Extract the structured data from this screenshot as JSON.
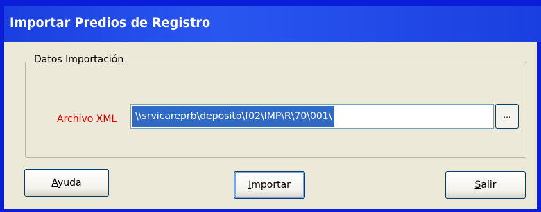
{
  "window": {
    "title": "Importar Predios de Registro"
  },
  "group": {
    "label": "Datos Importación"
  },
  "file_field": {
    "label": "Archivo XML",
    "value": "\\\\srvicareprb\\deposito\\f02\\IMP\\R\\70\\001\\",
    "browse_label": "..."
  },
  "buttons": {
    "help": {
      "mnemonic": "A",
      "rest": "yuda"
    },
    "import": {
      "mnemonic": "I",
      "rest": "mportar"
    },
    "exit": {
      "mnemonic": "S",
      "rest": "alir"
    }
  },
  "colors": {
    "title_bar": "#2a56f0",
    "selection": "#316ac5",
    "field_label": "#e00000",
    "dialog_bg": "#ece9d8"
  }
}
